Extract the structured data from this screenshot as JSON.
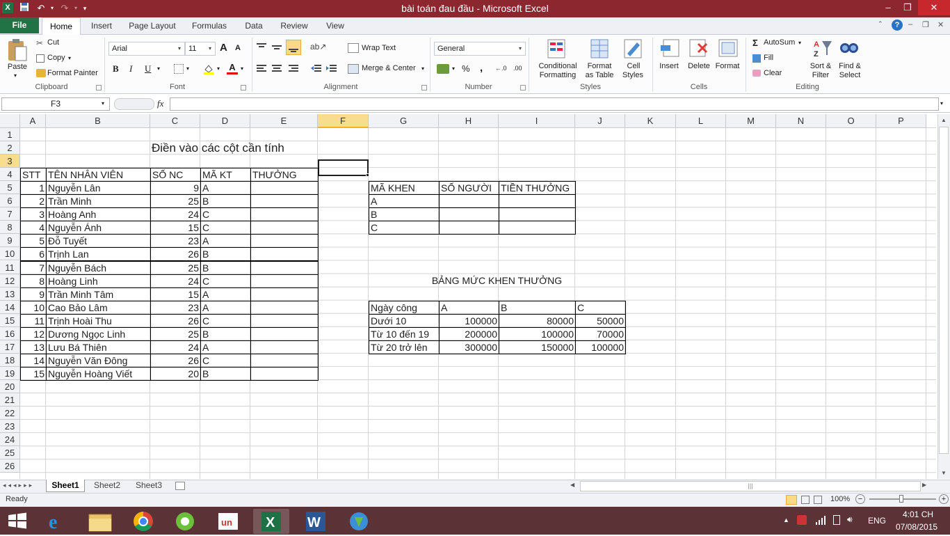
{
  "window": {
    "title": "bài toán đau đầu - Microsoft Excel",
    "minimize": "–",
    "restore": "❐",
    "close": "✕",
    "help": "?"
  },
  "qat": {
    "save": "💾",
    "undo": "↶",
    "redo": "↷",
    "customize": "▾"
  },
  "tabs": [
    "File",
    "Home",
    "Insert",
    "Page Layout",
    "Formulas",
    "Data",
    "Review",
    "View"
  ],
  "ribbon": {
    "clipboard": {
      "group": "Clipboard",
      "paste": "Paste",
      "cut": "Cut",
      "copy": "Copy",
      "format_painter": "Format Painter"
    },
    "font": {
      "group": "Font",
      "name": "Arial",
      "size": "11",
      "bold": "B",
      "italic": "I",
      "underline": "U",
      "grow": "A",
      "shrink": "A"
    },
    "alignment": {
      "group": "Alignment",
      "wrap": "Wrap Text",
      "merge": "Merge & Center"
    },
    "number": {
      "group": "Number",
      "format": "General",
      "percent": "%",
      "comma": ",",
      "dec_inc": "←.0",
      ".00": ".00"
    },
    "styles": {
      "group": "Styles",
      "conditional": "Conditional",
      "conditional2": "Formatting",
      "format_table": "Format",
      "format_table2": "as Table",
      "cell_styles": "Cell",
      "cell_styles2": "Styles"
    },
    "cells": {
      "group": "Cells",
      "insert": "Insert",
      "delete": "Delete",
      "format": "Format"
    },
    "editing": {
      "group": "Editing",
      "autosum": "AutoSum",
      "fill": "Fill",
      "clear": "Clear",
      "sort": "Sort &",
      "sort2": "Filter",
      "find": "Find &",
      "find2": "Select"
    }
  },
  "formula_bar": {
    "name_box": "F3",
    "fx": "fx",
    "content": ""
  },
  "columns": [
    "A",
    "B",
    "C",
    "D",
    "E",
    "F",
    "G",
    "H",
    "I",
    "J",
    "K",
    "L",
    "M",
    "N",
    "O",
    "P"
  ],
  "rows": [
    "1",
    "2",
    "3",
    "4",
    "5",
    "6",
    "7",
    "8",
    "9",
    "10",
    "11",
    "12",
    "13",
    "14",
    "15",
    "16",
    "17",
    "18",
    "19",
    "20",
    "21",
    "22",
    "23",
    "24",
    "25",
    "26"
  ],
  "sheet": {
    "title": "Điền vào các cột cần tính",
    "headers": [
      "STT",
      "TÊN NHÂN VIÊN",
      "SỐ NC",
      "MÃ KT",
      "THƯỞNG"
    ],
    "employees": [
      [
        "1",
        "Nguyễn Lân",
        "9",
        "A"
      ],
      [
        "2",
        "Trần Minh",
        "25",
        "B"
      ],
      [
        "3",
        "Hoàng Anh",
        "24",
        "C"
      ],
      [
        "4",
        "Nguyễn Ánh",
        "15",
        "C"
      ],
      [
        "5",
        "Đỗ Tuyết",
        "23",
        "A"
      ],
      [
        "6",
        "Trịnh Lan",
        "26",
        "B"
      ],
      [
        "7",
        "Nguyễn Bách",
        "25",
        "B"
      ],
      [
        "8",
        "Hoàng Linh",
        "24",
        "C"
      ],
      [
        "9",
        "Trần Minh Tâm",
        "15",
        "A"
      ],
      [
        "10",
        "Cao Bảo Lâm",
        "23",
        "A"
      ],
      [
        "11",
        "Trịnh Hoài Thu",
        "26",
        "C"
      ],
      [
        "12",
        "Dương Ngọc Linh",
        "25",
        "B"
      ],
      [
        "13",
        "Lưu Bá Thiên",
        "24",
        "A"
      ],
      [
        "14",
        "Nguyễn Văn Đông",
        "26",
        "C"
      ],
      [
        "15",
        "Nguyễn Hoàng Viết",
        "20",
        "B"
      ]
    ],
    "summary_headers": [
      "MÃ KHEN",
      "SỐ NGƯỜI",
      "TIỀN THƯỞNG"
    ],
    "summary_rows": [
      "A",
      "B",
      "C"
    ],
    "bonus_title": "BẢNG MỨC KHEN THƯỞNG",
    "bonus_headers": [
      "Ngày công",
      "A",
      "B",
      "C"
    ],
    "bonus_rows": [
      [
        "Dưới 10",
        "100000",
        "80000",
        "50000"
      ],
      [
        "Từ 10 đến  19",
        "200000",
        "100000",
        "70000"
      ],
      [
        "Từ 20 trở lên",
        "300000",
        "150000",
        "100000"
      ]
    ]
  },
  "sheet_tabs": [
    "Sheet1",
    "Sheet2",
    "Sheet3"
  ],
  "status": {
    "ready": "Ready",
    "zoom": "100%"
  },
  "taskbar": {
    "lang": "ENG",
    "time": "4:01 CH",
    "date": "07/08/2015"
  }
}
